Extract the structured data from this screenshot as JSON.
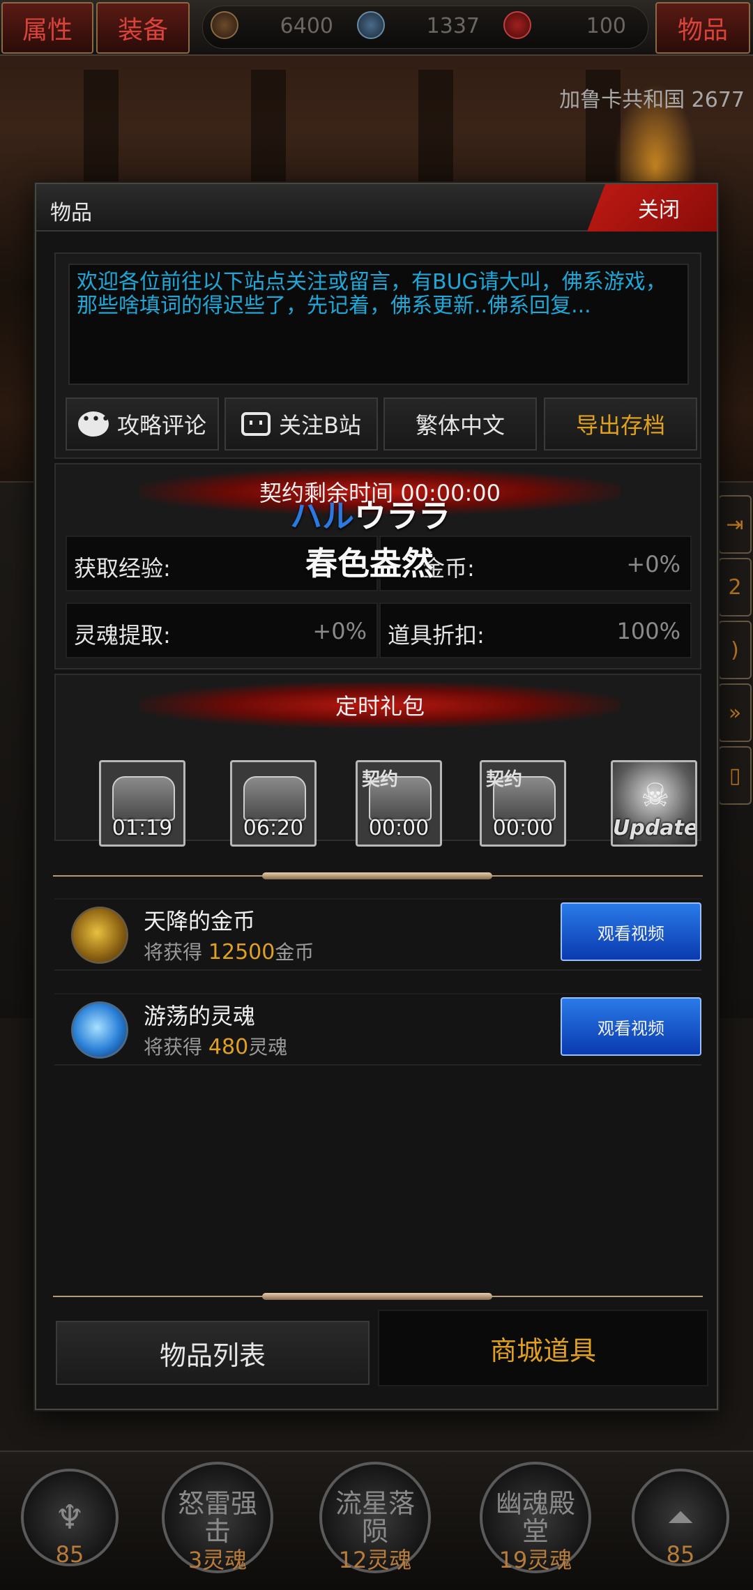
{
  "top_bar": {
    "attributes_label": "属性",
    "equipment_label": "装备",
    "items_label": "物品",
    "resources": [
      "6400",
      "1337",
      "100"
    ]
  },
  "background": {
    "country": "加鲁卡共和国 2677"
  },
  "modal": {
    "title": "物品",
    "close_label": "关闭",
    "notice": "欢迎各位前往以下站点关注或留言，有BUG请大叫，佛系游戏，那些啥填词的得迟些了，先记着，佛系更新..佛系回复...",
    "links": [
      {
        "label": "攻略评论",
        "icon": "chat-icon"
      },
      {
        "label": "关注B站",
        "icon": "bilibili-icon"
      },
      {
        "label": "繁体中文"
      },
      {
        "label": "导出存档"
      }
    ],
    "contract": {
      "title": "契约剩余时间 00:00:00",
      "stats": [
        {
          "label": "获取经验:",
          "value": ""
        },
        {
          "label": "金币:",
          "value": "+0%"
        },
        {
          "label": "灵魂提取:",
          "value": "+0%"
        },
        {
          "label": "道具折扣:",
          "value": "100%"
        }
      ]
    },
    "overlay": {
      "line1_blue": "ハル",
      "line1_white": "ウララ",
      "line2": "春色盎然"
    },
    "gift": {
      "title": "定时礼包",
      "items": [
        {
          "tag": "",
          "time": "01:19"
        },
        {
          "tag": "",
          "time": "06:20"
        },
        {
          "tag": "契约",
          "time": "00:00"
        },
        {
          "tag": "契约",
          "time": "00:00"
        },
        {
          "tag": "Update",
          "time": ""
        }
      ]
    },
    "rewards": [
      {
        "name": "天降的金币",
        "prefix": "将获得",
        "amount": "12500",
        "unit": "金币",
        "button": "观看视频"
      },
      {
        "name": "游荡的灵魂",
        "prefix": "将获得",
        "amount": "480",
        "unit": "灵魂",
        "button": "观看视频"
      }
    ],
    "tabs": {
      "list": "物品列表",
      "shop": "商城道具"
    }
  },
  "skills": [
    {
      "name": "",
      "cost": "85"
    },
    {
      "name": "怒雷强击",
      "cost": "3灵魂"
    },
    {
      "name": "流星落陨",
      "cost": "12灵魂"
    },
    {
      "name": "幽魂殿堂",
      "cost": "19灵魂"
    },
    {
      "name": "",
      "cost": "85"
    }
  ]
}
